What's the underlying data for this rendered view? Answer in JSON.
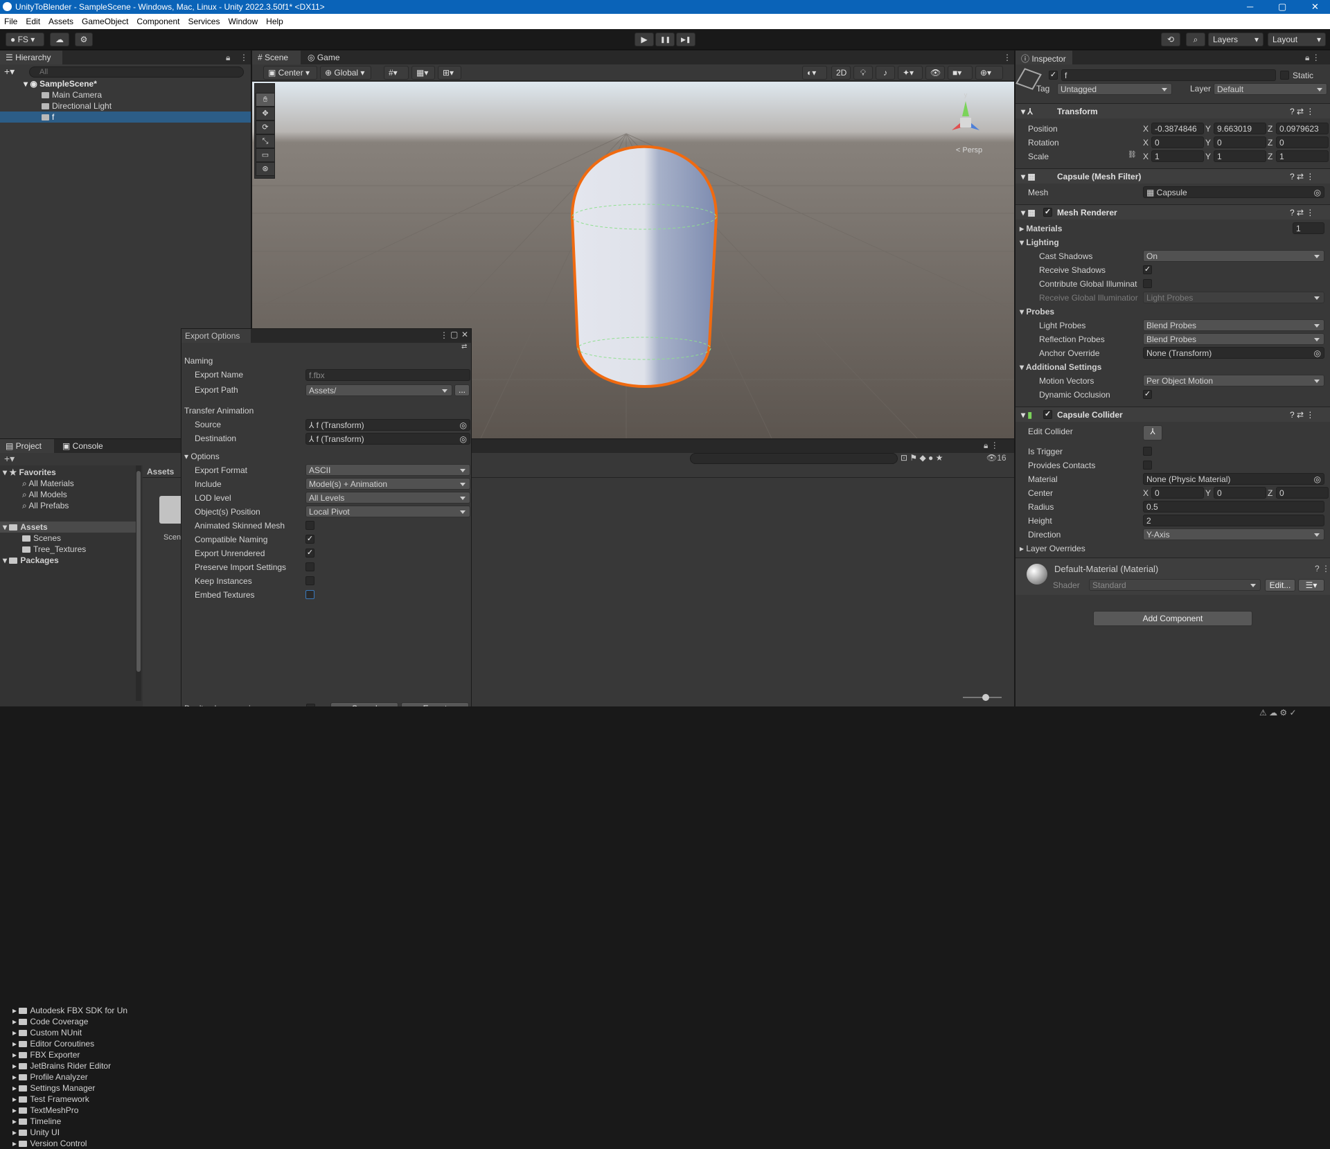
{
  "titlebar": {
    "title": "UnityToBlender - SampleScene - Windows, Mac, Linux - Unity 2022.3.50f1* <DX11>",
    "minimize": "─",
    "maximize": "▢",
    "close": "✕"
  },
  "menu": [
    "File",
    "Edit",
    "Assets",
    "GameObject",
    "Component",
    "Services",
    "Window",
    "Help"
  ],
  "toolbar": {
    "account": "FS",
    "layers": "Layers",
    "layout": "Layout",
    "play": "▶",
    "pause": "❚❚",
    "step": "▶❚"
  },
  "hierarchy": {
    "tab": "Hierarchy",
    "search_placeholder": "All",
    "scene": "SampleScene*",
    "items": [
      "Main Camera",
      "Directional Light",
      "f"
    ]
  },
  "scene_tabs": {
    "scene": "Scene",
    "game": "Game"
  },
  "scene_toolbar": {
    "center": "Center",
    "global": "Global",
    "mode_2d": "2D",
    "persp": "< Persp"
  },
  "project": {
    "tab_project": "Project",
    "tab_console": "Console",
    "favorites": "Favorites",
    "fav_items": [
      "All Materials",
      "All Models",
      "All Prefabs"
    ],
    "assets": "Assets",
    "asset_items": [
      "Scenes",
      "Tree_Textures"
    ],
    "packages": "Packages",
    "package_items": [
      "Autodesk FBX SDK for Un",
      "Code Coverage",
      "Custom NUnit",
      "Editor Coroutines",
      "FBX Exporter",
      "JetBrains Rider Editor",
      "Profile Analyzer",
      "Settings Manager",
      "Test Framework",
      "TextMeshPro",
      "Timeline",
      "Unity UI",
      "Version Control"
    ],
    "breadcrumb": "Assets",
    "grid_item": "Scen",
    "hidden_count": "16"
  },
  "export": {
    "title": "Export Options",
    "naming": "Naming",
    "export_name_label": "Export Name",
    "export_name_value": "f.fbx",
    "export_path_label": "Export Path",
    "export_path_value": "Assets/",
    "browse": "...",
    "transfer": "Transfer Animation",
    "source_label": "Source",
    "source_value": "f (Transform)",
    "dest_label": "Destination",
    "dest_value": "f (Transform)",
    "options": "Options",
    "rows": [
      {
        "label": "Export Format",
        "value": "ASCII"
      },
      {
        "label": "Include",
        "value": "Model(s) + Animation"
      },
      {
        "label": "LOD level",
        "value": "All Levels"
      },
      {
        "label": "Object(s) Position",
        "value": "Local Pivot"
      }
    ],
    "checks": [
      {
        "label": "Animated Skinned Mesh",
        "checked": false
      },
      {
        "label": "Compatible Naming",
        "checked": true
      },
      {
        "label": "Export Unrendered",
        "checked": true
      },
      {
        "label": "Preserve Import Settings",
        "checked": false
      },
      {
        "label": "Keep Instances",
        "checked": false
      },
      {
        "label": "Embed Textures",
        "checked": false
      }
    ],
    "dont_ask": "Don't ask me again",
    "cancel": "Cancel",
    "export_btn": "Export"
  },
  "inspector": {
    "tab": "Inspector",
    "name": "f",
    "static": "Static",
    "tag_label": "Tag",
    "tag_value": "Untagged",
    "layer_label": "Layer",
    "layer_value": "Default",
    "transform": {
      "title": "Transform",
      "position": "Position",
      "rotation": "Rotation",
      "scale": "Scale",
      "pos": [
        "-0.3874846",
        "9.663019",
        "0.0979623"
      ],
      "rot": [
        "0",
        "0",
        "0"
      ],
      "scl": [
        "1",
        "1",
        "1"
      ]
    },
    "mesh_filter": {
      "title": "Capsule (Mesh Filter)",
      "mesh_label": "Mesh",
      "mesh_value": "Capsule"
    },
    "mesh_renderer": {
      "title": "Mesh Renderer",
      "materials": "Materials",
      "materials_count": "1",
      "lighting": "Lighting",
      "cast_shadows": "Cast Shadows",
      "cast_value": "On",
      "receive_shadows": "Receive Shadows",
      "contribute_gi": "Contribute Global Illuminat",
      "receive_gi": "Receive Global Illuminatior",
      "receive_gi_value": "Light Probes",
      "probes": "Probes",
      "light_probes": "Light Probes",
      "light_probes_value": "Blend Probes",
      "reflection_probes": "Reflection Probes",
      "reflection_value": "Blend Probes",
      "anchor": "Anchor Override",
      "anchor_value": "None (Transform)",
      "additional": "Additional Settings",
      "motion": "Motion Vectors",
      "motion_value": "Per Object Motion",
      "dynamic": "Dynamic Occlusion"
    },
    "collider": {
      "title": "Capsule Collider",
      "edit": "Edit Collider",
      "trigger": "Is Trigger",
      "contacts": "Provides Contacts",
      "material": "Material",
      "material_value": "None (Physic Material)",
      "center": "Center",
      "center_vals": [
        "0",
        "0",
        "0"
      ],
      "radius": "Radius",
      "radius_value": "0.5",
      "height": "Height",
      "height_value": "2",
      "direction": "Direction",
      "direction_value": "Y-Axis",
      "layer_overrides": "Layer Overrides"
    },
    "material": {
      "title": "Default-Material (Material)",
      "shader_label": "Shader",
      "shader_value": "Standard",
      "edit": "Edit..."
    },
    "add_component": "Add Component"
  },
  "colors": {
    "titlebar": "#0a63b8",
    "selection": "#2c5d87",
    "outline": "#f06a10"
  }
}
